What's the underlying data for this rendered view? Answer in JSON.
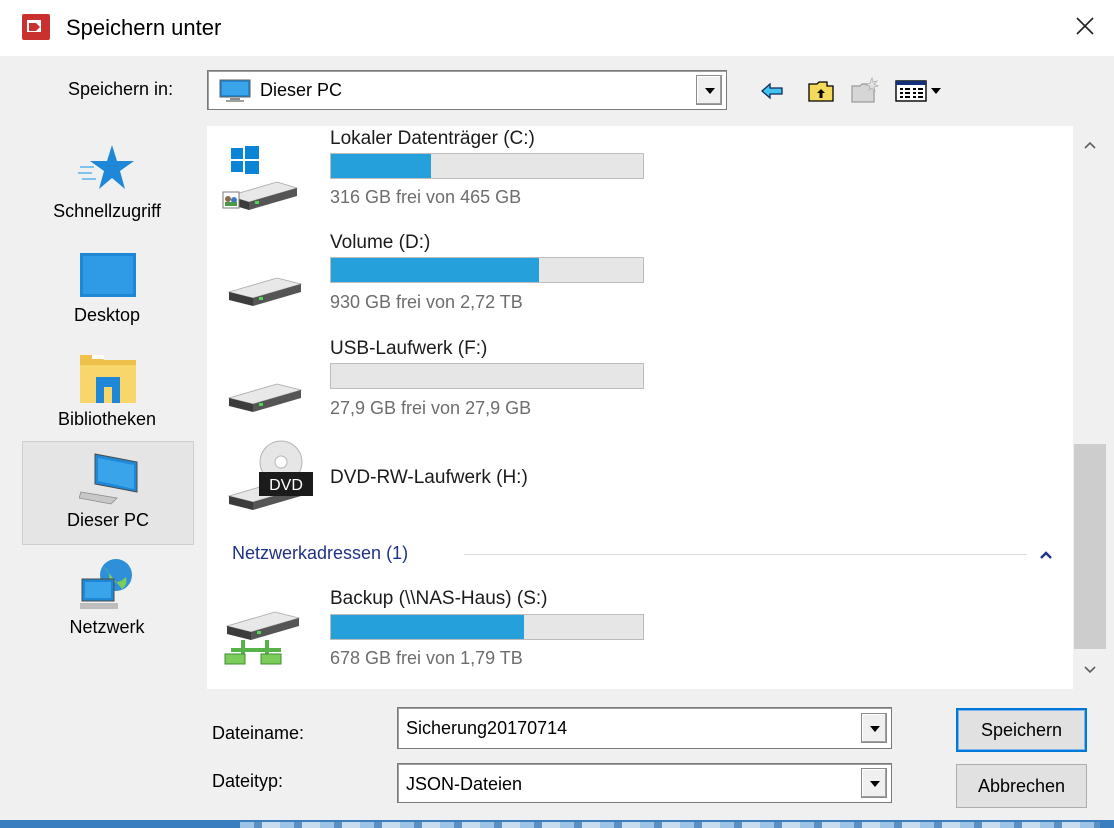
{
  "window": {
    "title": "Speichern unter",
    "close_icon": "close-icon",
    "app_icon": "app-icon"
  },
  "toolbar": {
    "lookin_label": "Speichern in:",
    "lookin_value": "Dieser PC",
    "icons": [
      "back-arrow-icon",
      "up-folder-icon",
      "new-folder-icon",
      "view-menu-icon"
    ]
  },
  "places": [
    {
      "label": "Schnellzugriff",
      "icon": "star-icon",
      "selected": false
    },
    {
      "label": "Desktop",
      "icon": "desktop-icon",
      "selected": false
    },
    {
      "label": "Bibliotheken",
      "icon": "library-icon",
      "selected": false
    },
    {
      "label": "Dieser PC",
      "icon": "computer-icon",
      "selected": true
    },
    {
      "label": "Netzwerk",
      "icon": "network-icon",
      "selected": false
    }
  ],
  "drives": [
    {
      "name": "Lokaler Datenträger (C:)",
      "free_text": "316 GB frei von 465 GB",
      "used_fraction": 0.32
    },
    {
      "name": "Volume (D:)",
      "free_text": "930 GB frei von 2,72 TB",
      "used_fraction": 0.667
    },
    {
      "name": "USB-Laufwerk (F:)",
      "free_text": "27,9 GB frei von 27,9 GB",
      "used_fraction": 0.0
    },
    {
      "name": "DVD-RW-Laufwerk (H:)",
      "dvd_label": "DVD"
    },
    {
      "name": "Backup (\\\\NAS-Haus) (S:)",
      "free_text": "678 GB frei von 1,79 TB",
      "used_fraction": 0.62
    }
  ],
  "group": {
    "header": "Netzwerkadressen (1)"
  },
  "bottom": {
    "filename_label": "Dateiname:",
    "filename_value": "Sicherung20170714",
    "filetype_label": "Dateityp:",
    "filetype_value": "JSON-Dateien",
    "save_label": "Speichern",
    "cancel_label": "Abbrechen"
  },
  "colors": {
    "accent": "#26a0da",
    "group_header": "#1e3287",
    "default_button_border": "#0078d7"
  }
}
